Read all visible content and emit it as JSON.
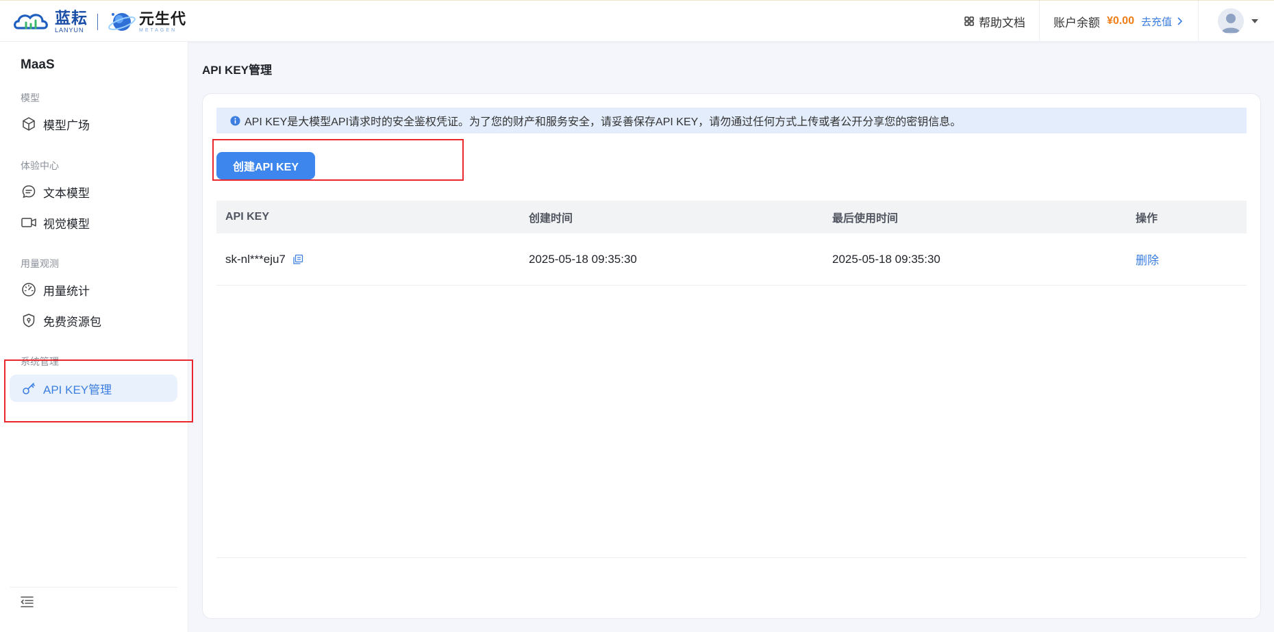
{
  "header": {
    "brand1_cn": "蓝耘",
    "brand1_en": "LANYUN",
    "brand2_cn": "元生代",
    "brand2_en": "METAGEN",
    "help_label": "帮助文档",
    "balance_label": "账户余额",
    "balance_amount": "¥0.00",
    "recharge_label": "去充值"
  },
  "sidebar": {
    "title": "MaaS",
    "groups": [
      {
        "label": "模型",
        "items": [
          {
            "label": "模型广场",
            "icon": "cube-icon"
          }
        ]
      },
      {
        "label": "体验中心",
        "items": [
          {
            "label": "文本模型",
            "icon": "chat-icon"
          },
          {
            "label": "视觉模型",
            "icon": "video-icon"
          }
        ]
      },
      {
        "label": "用量观测",
        "items": [
          {
            "label": "用量统计",
            "icon": "gauge-icon"
          },
          {
            "label": "免费资源包",
            "icon": "shield-icon"
          }
        ]
      },
      {
        "label": "系统管理",
        "items": [
          {
            "label": "API KEY管理",
            "icon": "key-icon",
            "active": true
          }
        ]
      }
    ]
  },
  "main": {
    "page_title": "API KEY管理",
    "notice": "API KEY是大模型API请求时的安全鉴权凭证。为了您的财产和服务安全，请妥善保存API KEY，请勿通过任何方式上传或者公开分享您的密钥信息。",
    "create_button": "创建API KEY",
    "table": {
      "columns": [
        "API KEY",
        "创建时间",
        "最后使用时间",
        "操作"
      ],
      "rows": [
        {
          "api_key": "sk-nl***eju7",
          "created": "2025-05-18 09:35:30",
          "last_used": "2025-05-18 09:35:30",
          "action": "删除"
        }
      ]
    }
  },
  "colors": {
    "accent": "#3d86ee",
    "link": "#3b7ee0",
    "balance": "#f07d17",
    "highlight_box": "#e8262b"
  }
}
